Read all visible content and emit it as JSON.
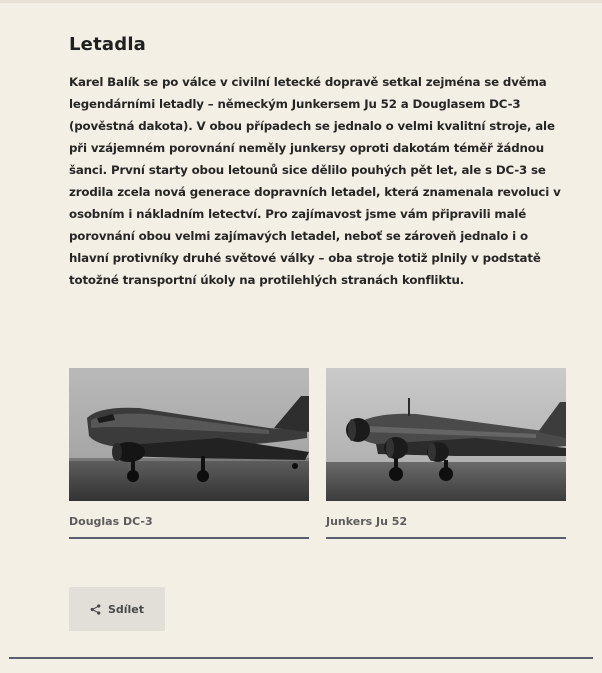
{
  "article": {
    "title": "Letadla",
    "body": "Karel Balík se po válce v civilní letecké dopravě setkal zejména se dvěma legendárními letadly – německým Junkersem Ju 52 a Douglasem DC-3 (pověstná dakota). V obou případech se jednalo o velmi kvalitní stroje, ale při vzájemném porovnání neměly junkersy oproti dakotám téměř žádnou šanci. První starty obou letounů sice dělilo pouhých pět let, ale s DC-3 se zrodila zcela nová generace dopravních letadel, která znamenala revoluci v osobním i nákladním letectví. Pro zajímavost jsme vám připravili malé porovnání obou velmi zajímavých letadel, neboť se zároveň jednalo i o hlavní protivníky druhé světové války – oba stroje totiž plnily v podstatě totožné transportní úkoly na protilehlých stranách konfliktu."
  },
  "gallery": [
    {
      "caption": "Douglas DC-3"
    },
    {
      "caption": "Junkers Ju 52"
    }
  ],
  "share": {
    "label": "Sdílet",
    "icon": "share-icon"
  }
}
